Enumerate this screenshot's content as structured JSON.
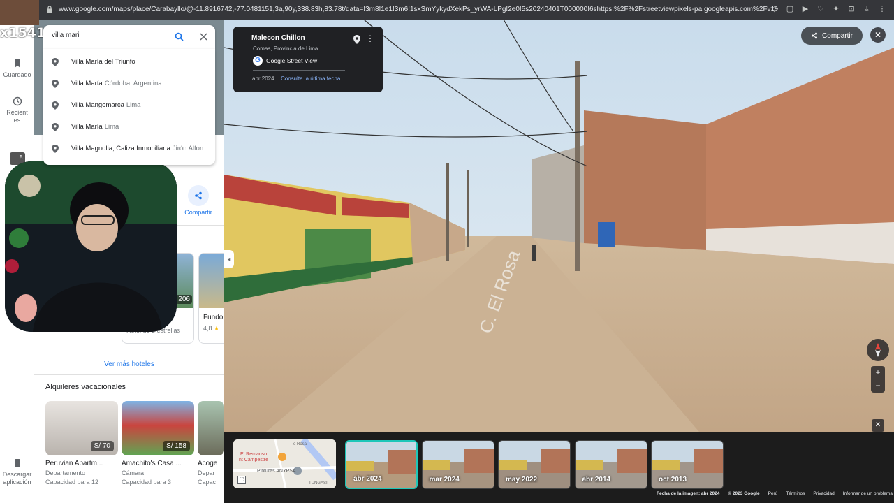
{
  "browser": {
    "url": "www.google.com/maps/place/Carabayllo/@-11.8916742,-77.0481151,3a,90y,338.83h,83.78t/data=!3m8!1e1!3m6!1sxSmYykydXekPs_yrWA-LPg!2e0!5s20240401T000000!6shttps:%2F%2Fstreetviewpixels-pa.googleapis.com%2Fv1%2Fthumbnail%3Fcb"
  },
  "stream": {
    "counter": "x1541"
  },
  "rail": {
    "saved": "Guardado",
    "recent": "Recientes",
    "recent_badge": "5",
    "download": "Descargar aplicación"
  },
  "search": {
    "value": "villa mari",
    "suggestions": [
      {
        "main": "Villa María del Triunfo",
        "sub": ""
      },
      {
        "main": "Villa María",
        "sub": "Córdoba, Argentina"
      },
      {
        "main": "Villa Mangomarca",
        "sub": "Lima"
      },
      {
        "main": "Villa María",
        "sub": "Lima"
      },
      {
        "main": "Villa Magnolia, Caliza Inmobiliaria",
        "sub": "Jirón Alfon..."
      }
    ]
  },
  "panel": {
    "share_label": "Compartir",
    "hotels": [
      {
        "title": "a Li...",
        "sub": "Hotel de 3 estrellas",
        "badge": "206"
      },
      {
        "title": "Fundo",
        "sub": "4,8",
        "badge": ""
      }
    ],
    "see_more_hotels": "Ver más hoteles",
    "rentals_heading": "Alquileres vacacionales",
    "rentals": [
      {
        "title": "Peruvian Apartm...",
        "type": "Departamento",
        "capacity": "Capacidad para 12",
        "price": "S/ 70"
      },
      {
        "title": "Amachito's Casa ...",
        "type": "Cámara",
        "capacity": "Capacidad para 3",
        "price": "S/ 158"
      },
      {
        "title": "Acoge",
        "type": "Depar",
        "capacity": "Capac",
        "price": ""
      }
    ]
  },
  "streetview": {
    "place_name": "Malecon Chillon",
    "place_sub": "Comas, Provincia de Lima",
    "source_label": "Google Street View",
    "date": "abr 2024",
    "latest_link": "Consulta la última fecha",
    "share": "Compartir",
    "road_text": "C. El Rosa"
  },
  "filmstrip": {
    "map_texts": [
      "El Remanso",
      "nt Campestre",
      "Pinturas ANYPSA",
      "o Rosa",
      "TUNGASI"
    ],
    "thumbs": [
      {
        "label": "abr 2024",
        "selected": true
      },
      {
        "label": "mar 2024",
        "selected": false
      },
      {
        "label": "may 2022",
        "selected": false
      },
      {
        "label": "abr 2014",
        "selected": false
      },
      {
        "label": "oct 2013",
        "selected": false
      }
    ]
  },
  "footer": {
    "image_date": "Fecha de la imagen: abr 2024",
    "copyright": "© 2023 Google",
    "country": "Perú",
    "terms": "Términos",
    "privacy": "Privacidad",
    "report": "Informar de un problema"
  },
  "colors": {
    "accent": "#1a73e8",
    "link": "#8ab4f8",
    "dark": "#202124",
    "selected_thumb": "#1ec6b8"
  }
}
